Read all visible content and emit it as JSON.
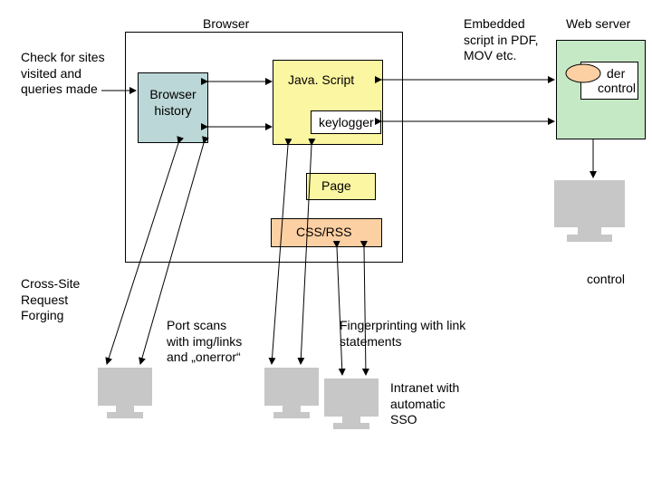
{
  "browserTitle": "Browser",
  "checkFor": "Check for sites visited and queries made",
  "browserHistory": "Browser history",
  "javascript": "Java. Script",
  "keylogger": "keylogger",
  "page": "Page",
  "cssRss": "CSS/RSS",
  "embedded": "Embedded script in PDF, MOV etc.",
  "webserver": "Web server",
  "under": "der",
  "control": "control",
  "crossSite": "Cross-Site Request Forging",
  "portScans": "Port scans with img/links and „onerror“",
  "fingerprinting": "Fingerprinting with link statements",
  "intranet": "Intranet with automatic SSO",
  "controlBottom": "control"
}
